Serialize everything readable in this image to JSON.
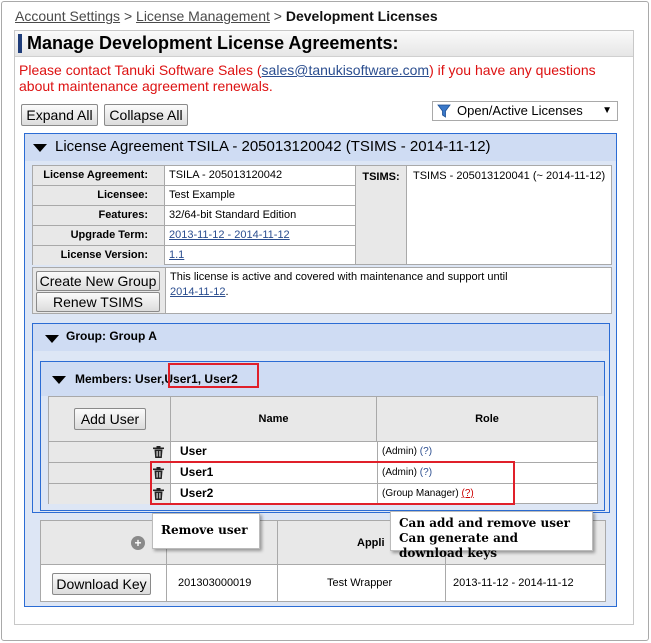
{
  "breadcrumb": {
    "account_settings": "Account Settings",
    "sep1": ">",
    "license_management": "License Management",
    "sep2": ">",
    "current": "Development Licenses"
  },
  "panel_title": "Manage Development License Agreements:",
  "notice": {
    "pre": "Please contact Tanuki Software Sales (",
    "email": "sales@tanukisoftware.com",
    "post": ") if you have any questions about maintenance agreement renewals."
  },
  "toolbar": {
    "expand_all": "Expand All",
    "collapse_all": "Collapse All",
    "filter_value": "Open/Active Licenses"
  },
  "agreement": {
    "header": "License Agreement TSILA - 205013120042 (TSIMS - 2014-11-12)",
    "fields": [
      {
        "label": "License Agreement:",
        "value": "TSILA - 205013120042"
      },
      {
        "label": "Licensee:",
        "value": "Test Example"
      },
      {
        "label": "Features:",
        "value": "32/64-bit Standard Edition"
      },
      {
        "label": "Upgrade Term:",
        "value": "2013-11-12 - 2014-11-12"
      },
      {
        "label": "License Version:",
        "value": "1.1"
      }
    ],
    "tsims_label": "TSIMS:",
    "tsims_value": "TSIMS - 205013120041 (~ 2014-11-12)",
    "create_group": "Create New Group",
    "renew_tsims": "Renew TSIMS",
    "status_message": "This license is active and covered with maintenance and support until",
    "status_date": "2014-11-12",
    "status_end": "."
  },
  "group": {
    "header": "Group: Group A",
    "members_label": "Members:",
    "members_first": "User,",
    "members_rest": "User1, User2",
    "add_user": "Add User",
    "col_name": "Name",
    "col_role": "Role",
    "users": [
      {
        "name": "User",
        "role": "(Admin)",
        "help": "(?)"
      },
      {
        "name": "User1",
        "role": "(Admin)",
        "help": "(?)"
      },
      {
        "name": "User2",
        "role": "(Group Manager)",
        "help": "(?)"
      }
    ]
  },
  "keys": {
    "col_app": "Appli",
    "download_key": "Download Key",
    "key_id": "201303000019",
    "app_name": "Test Wrapper",
    "term": "2013-11-12 - 2014-11-12"
  },
  "callouts": {
    "remove_user": "Remove user",
    "can_add_remove": "Can add and remove user",
    "can_generate": "Can generate and download keys"
  },
  "colors": {
    "highlight": "#e0202a",
    "accent_border": "#2b6cd4",
    "notice_text": "#dd1111"
  }
}
